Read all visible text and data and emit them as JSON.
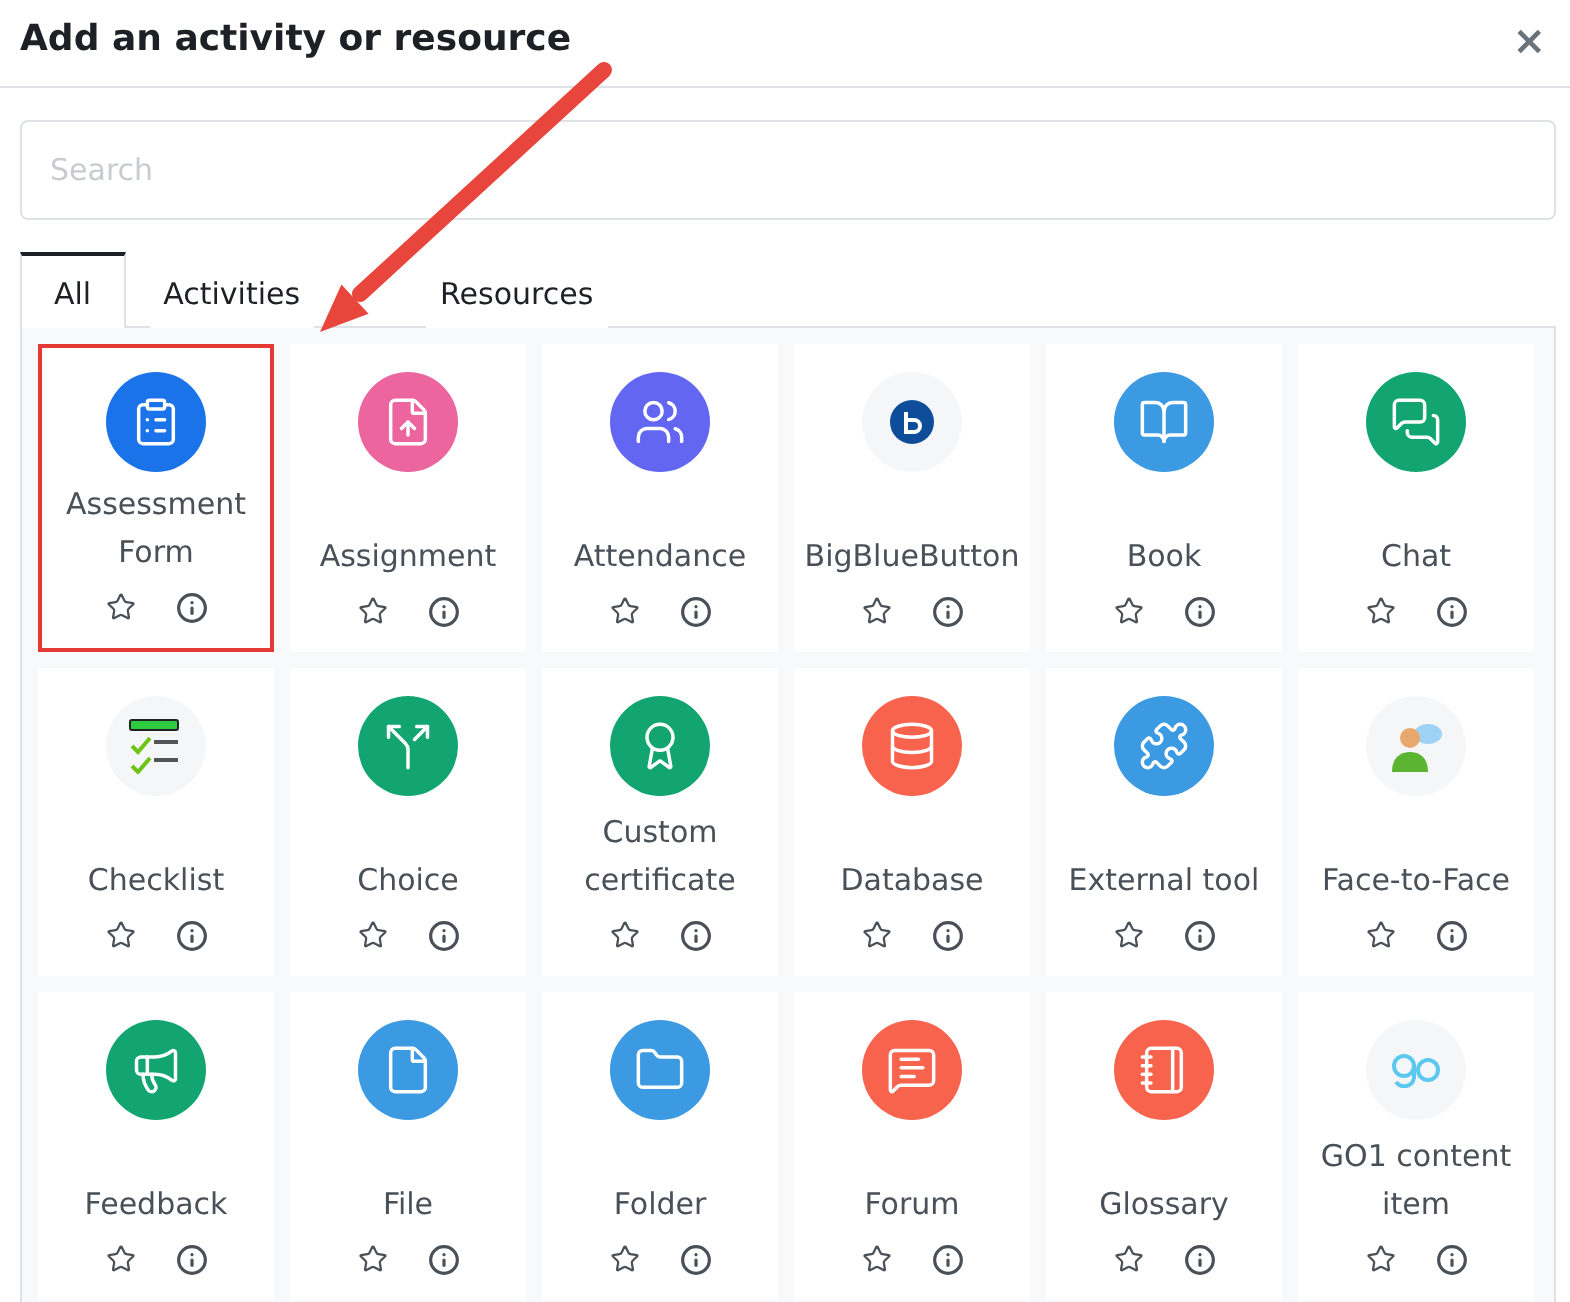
{
  "dialog": {
    "title": "Add an activity or resource",
    "close": "×"
  },
  "search": {
    "placeholder": "Search"
  },
  "tabs": [
    {
      "label": "All",
      "selected": true
    },
    {
      "label": "Activities",
      "selected": false
    },
    {
      "label": "Resources",
      "selected": false
    }
  ],
  "items": [
    {
      "label": "Assessment Form",
      "kind": "clipboard",
      "color": "#1a73e8",
      "highlighted": true,
      "starred": false
    },
    {
      "label": "Assignment",
      "kind": "upload",
      "color": "#ec659e",
      "highlighted": false,
      "starred": false
    },
    {
      "label": "Attendance",
      "kind": "people",
      "color": "#6366f1",
      "highlighted": false,
      "starred": false
    },
    {
      "label": "BigBlueButton",
      "kind": "bbb",
      "color": "#f5f6f8",
      "highlighted": false,
      "starred": false
    },
    {
      "label": "Book",
      "kind": "book",
      "color": "#3c9ae2",
      "highlighted": false,
      "starred": false
    },
    {
      "label": "Chat",
      "kind": "chat",
      "color": "#12a572",
      "highlighted": false,
      "starred": false
    },
    {
      "label": "Checklist",
      "kind": "checklist",
      "color": "#f5f6f8",
      "highlighted": false,
      "starred": false
    },
    {
      "label": "Choice",
      "kind": "split",
      "color": "#12a572",
      "highlighted": false,
      "starred": false
    },
    {
      "label": "Custom certificate",
      "kind": "certificate",
      "color": "#12a572",
      "highlighted": false,
      "starred": false
    },
    {
      "label": "Database",
      "kind": "database",
      "color": "#f7634d",
      "highlighted": false,
      "starred": false
    },
    {
      "label": "External tool",
      "kind": "puzzle",
      "color": "#3c9ae2",
      "highlighted": false,
      "starred": false
    },
    {
      "label": "Face-to-Face",
      "kind": "person",
      "color": "#f5f6f8",
      "highlighted": false,
      "starred": false
    },
    {
      "label": "Feedback",
      "kind": "megaphone",
      "color": "#12a572",
      "highlighted": false,
      "starred": false
    },
    {
      "label": "File",
      "kind": "file",
      "color": "#3c9ae2",
      "highlighted": false,
      "starred": false
    },
    {
      "label": "Folder",
      "kind": "folder",
      "color": "#3c9ae2",
      "highlighted": false,
      "starred": false
    },
    {
      "label": "Forum",
      "kind": "forum",
      "color": "#f7634d",
      "highlighted": false,
      "starred": false
    },
    {
      "label": "Glossary",
      "kind": "notebook",
      "color": "#f7634d",
      "highlighted": false,
      "starred": false
    },
    {
      "label": "GO1 content item",
      "kind": "go1",
      "color": "#f5f6f8",
      "highlighted": false,
      "starred": false
    }
  ]
}
